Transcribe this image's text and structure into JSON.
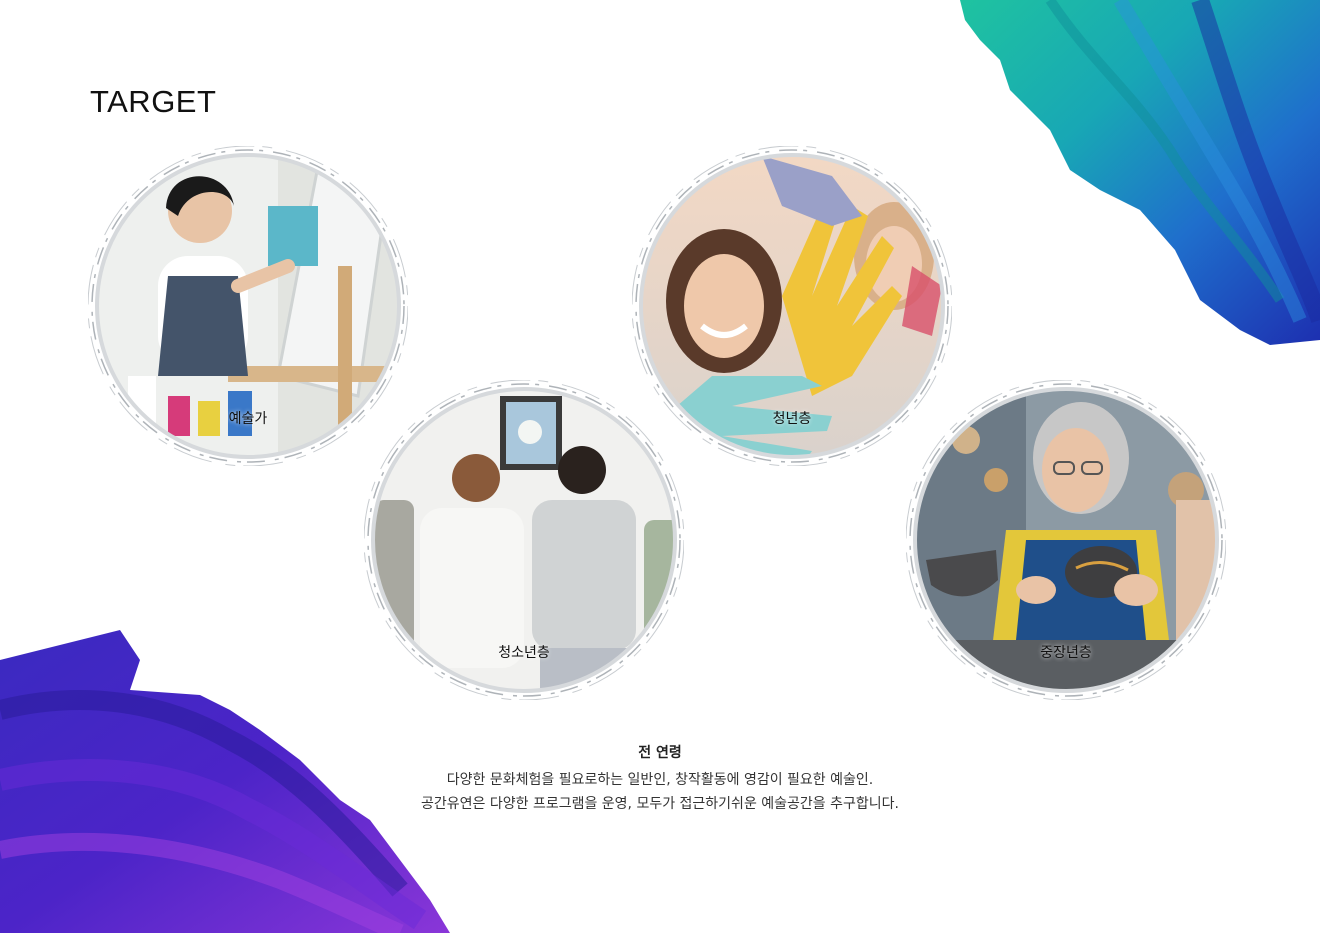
{
  "page": {
    "title": "TARGET"
  },
  "targets": [
    {
      "label": "예술가",
      "icon": "artist-painting-photo"
    },
    {
      "label": "청소년층",
      "icon": "youth-gallery-photo"
    },
    {
      "label": "청년층",
      "icon": "young-adults-paint-hands-photo"
    },
    {
      "label": "중장년층",
      "icon": "senior-pottery-photo"
    }
  ],
  "description": {
    "heading": "전 연령",
    "line1": "다양한 문화체험을 필요로하는 일반인, 창작활동에 영감이 필요한 예술인.",
    "line2": "공간유연은 다양한 프로그램을 운영, 모두가 접근하기쉬운 예술공간을 추구합니다."
  },
  "colors": {
    "paint_teal": "#1fb39a",
    "paint_blue": "#1f66c8",
    "paint_navy": "#1d2fb0",
    "paint_purple": "#5a2bd0",
    "paint_violet": "#8a36d8"
  }
}
